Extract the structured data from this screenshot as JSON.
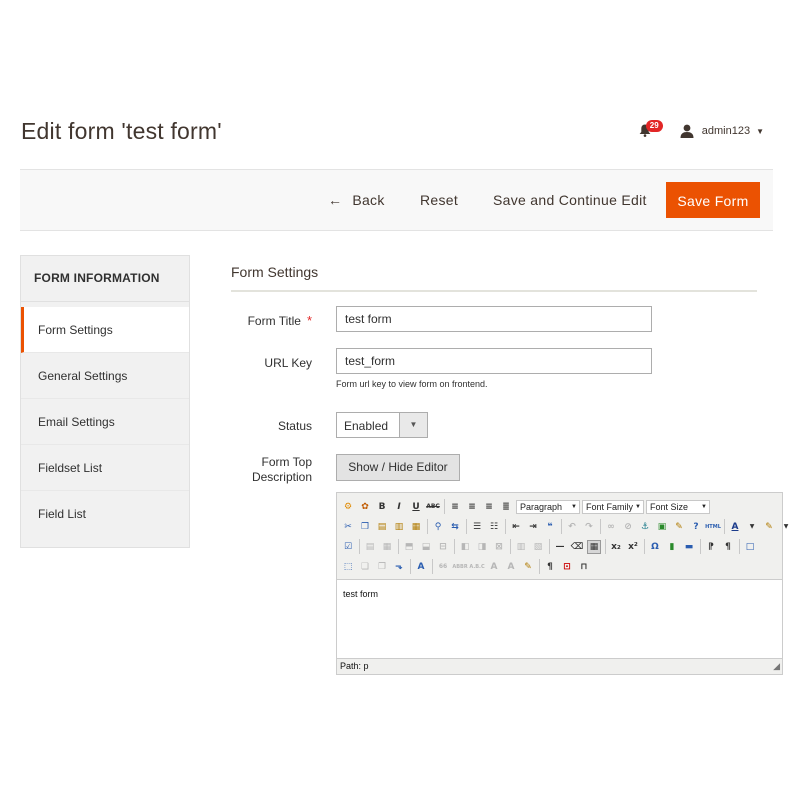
{
  "page": {
    "title": "Edit form 'test form'"
  },
  "header": {
    "notifications_count": "29",
    "user_name": "admin123"
  },
  "actions": {
    "back": "Back",
    "reset": "Reset",
    "save_continue": "Save and Continue Edit",
    "save": "Save Form"
  },
  "sidebar": {
    "title": "FORM INFORMATION",
    "items": [
      {
        "label": "Form Settings",
        "active": true
      },
      {
        "label": "General Settings"
      },
      {
        "label": "Email Settings"
      },
      {
        "label": "Fieldset List"
      },
      {
        "label": "Field List"
      }
    ]
  },
  "form": {
    "section_title": "Form Settings",
    "form_title_label": "Form Title",
    "form_title_value": "test form",
    "url_key_label": "URL Key",
    "url_key_value": "test_form",
    "url_key_note": "Form url key to view form on frontend.",
    "status_label": "Status",
    "status_value": "Enabled",
    "description_label_1": "Form Top",
    "description_label_2": "Description",
    "toggle_editor": "Show / Hide Editor"
  },
  "editor": {
    "format_select": "Paragraph",
    "font_family_select": "Font Family",
    "font_size_select": "Font Size",
    "content": "test form",
    "path": "Path: p"
  },
  "colors": {
    "accent": "#eb5202",
    "badge": "#e22626",
    "required": "#e22626"
  }
}
